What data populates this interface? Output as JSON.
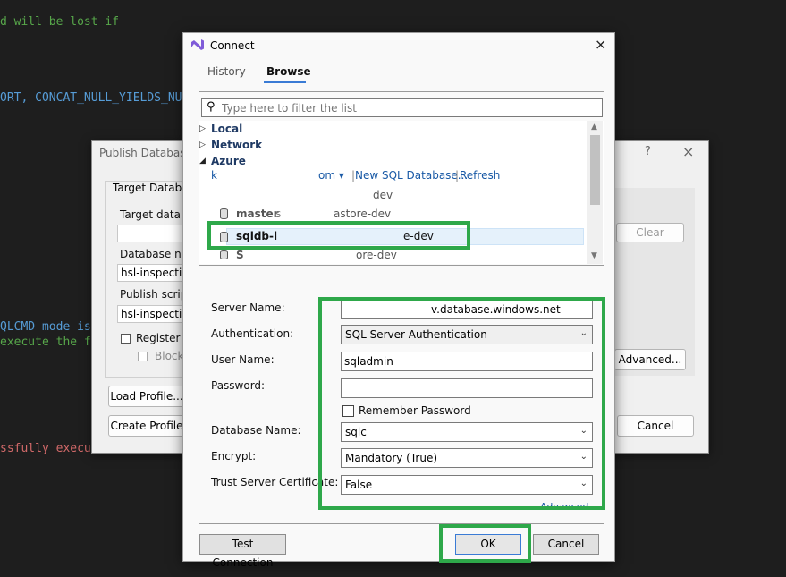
{
  "editor": {
    "line1": "d will be lost if",
    "line2": "ORT, CONCAT_NULL_YIELDS_NUL",
    "line3": "QLCMD mode is",
    "line4": "execute the fo",
    "line5": "ssfully execu"
  },
  "publish": {
    "title": "Publish Database",
    "help": "?",
    "close": "×",
    "group_label": "Target Database",
    "target_db_label": "Target databa",
    "database_name_label": "Database nam",
    "database_name_value": "hsl-inspection",
    "publish_script_label": "Publish script",
    "publish_script_value": "hsl-inspection",
    "register_label": "Register a",
    "block_label": "Block",
    "clear_button": "Clear",
    "advanced_button": "Advanced...",
    "load_profile_button": "Load Profile...",
    "create_profile_button": "Create Profile",
    "cancel_button": "Cancel"
  },
  "connect": {
    "title": "Connect",
    "close": "×",
    "tabs": {
      "history": "History",
      "browse": "Browse"
    },
    "filter_placeholder": "Type here to filter the list",
    "tree": {
      "local": "Local",
      "network": "Network",
      "azure": "Azure",
      "account_fragment_1": "k",
      "account_fragment_2": "om ▾",
      "new_db_link": "New SQL Database...",
      "refresh_link": "Refresh",
      "group_fragment": "dev",
      "items": [
        {
          "name": "master",
          "suffix": "astore-dev",
          "mid": "s"
        },
        {
          "name": "sqldb-l",
          "suffix": "e-dev",
          "mid": ""
        },
        {
          "name": "S",
          "suffix": "ore-dev",
          "mid": ""
        }
      ]
    },
    "fields": {
      "server_name_label": "Server Name:",
      "server_name_value": "v.database.windows.net",
      "authentication_label": "Authentication:",
      "authentication_value": "SQL Server Authentication",
      "user_name_label": "User Name:",
      "user_name_value": "sqladmin",
      "password_label": "Password:",
      "password_value": "",
      "remember_password_label": "Remember Password",
      "database_name_label": "Database Name:",
      "database_name_value": "sqlc",
      "encrypt_label": "Encrypt:",
      "encrypt_value": "Mandatory (True)",
      "trust_cert_label": "Trust Server Certificate:",
      "trust_cert_value": "False",
      "advanced_link": "Advanced..."
    },
    "buttons": {
      "test_connection": "Test Connection",
      "ok": "OK",
      "cancel": "Cancel"
    }
  },
  "colors": {
    "highlight": "#2ea84a",
    "accent": "#3a7bd5",
    "editor_bg": "#1e1e1e"
  }
}
